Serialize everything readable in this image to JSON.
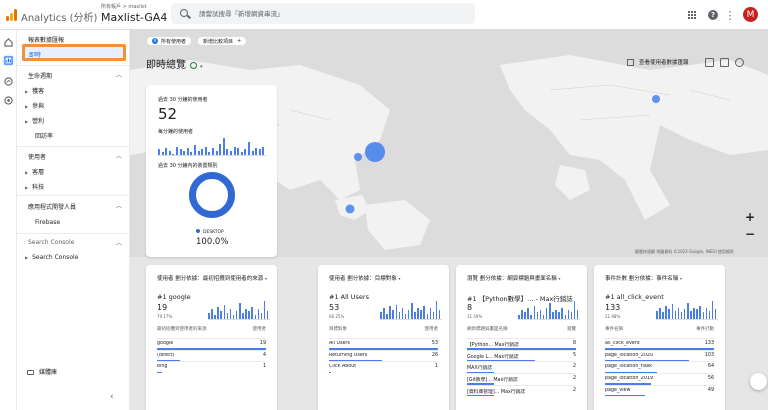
{
  "header": {
    "app_name": "Analytics (分析)",
    "breadcrumb": "所有帳戶 > maxlist",
    "property": "Maxlist-GA4",
    "search_placeholder": "請嘗試搜尋「新增網資串流」",
    "avatar_letter": "M"
  },
  "icons": {
    "logo": "analytics-logo-icon",
    "search": "search-icon",
    "apps": "apps-grid-icon",
    "help": "help-icon",
    "more": "more-vert-icon",
    "settings": "gear-icon"
  },
  "sidebar": {
    "title": "報表數據匯報",
    "active": "即時",
    "sections": [
      {
        "label": "生命週期",
        "items": [
          "獲客",
          "參與",
          "營利"
        ],
        "sub": [
          "回訪率"
        ]
      },
      {
        "label": "使用者",
        "items": [
          "客層",
          "科技"
        ]
      },
      {
        "label": "應用程式開發人員",
        "sub": [
          "Firebase"
        ]
      },
      {
        "label": "Search Console",
        "items": [
          "Search Console"
        ]
      }
    ],
    "library": "媒體庫"
  },
  "main": {
    "chips": [
      "所有使用者",
      "新增比較項目"
    ],
    "page_title": "即時總覽",
    "compare_button": "查看使用者數據匯報",
    "map_credit": "鍵盤快速鍵  地圖資料 ©2023 Google, INEGI  使用條款",
    "zoom_in": "+",
    "zoom_out": "−"
  },
  "realtime_card": {
    "users_label": "過去 30 分鐘的使用者",
    "users_value": "52",
    "per_minute_label": "每分鐘的使用者",
    "device_label": "過去 30 分鐘內的裝置類別",
    "device_name": "DESKTOP",
    "device_pct": "100.0%",
    "per_minute_values": [
      4,
      2,
      5,
      3,
      1,
      6,
      4,
      3,
      5,
      2,
      7,
      3,
      4,
      6,
      2,
      5,
      3,
      8,
      12,
      4,
      3,
      6,
      5,
      2,
      4,
      9,
      3,
      5,
      4,
      6
    ]
  },
  "cards": [
    {
      "title": "使用者 劃分依據：最初招攬到使用者的來源",
      "top_label": "#1  google",
      "top_value": "19",
      "top_pct": "79.17%",
      "col_left": "最初招攬到使用者的來源",
      "col_right": "使用者",
      "rows": [
        {
          "label": "google",
          "value": "19",
          "fill": 1.0
        },
        {
          "label": "(direct)",
          "value": "4",
          "fill": 0.21
        },
        {
          "label": "bing",
          "value": "1",
          "fill": 0.05
        }
      ],
      "bars": [
        3,
        5,
        2,
        6,
        4,
        7,
        3,
        5,
        2,
        4,
        8,
        3,
        5,
        4,
        6,
        2,
        5,
        3,
        9,
        4
      ]
    },
    {
      "title": "使用者 劃分依據：目標對象",
      "top_label": "#1  All Users",
      "top_value": "53",
      "top_pct": "66.25%",
      "col_left": "目標對象",
      "col_right": "使用者",
      "rows": [
        {
          "label": "All Users",
          "value": "53",
          "fill": 1.0
        },
        {
          "label": "Returning Users",
          "value": "26",
          "fill": 0.49
        },
        {
          "label": "Click About",
          "value": "1",
          "fill": 0.02
        }
      ],
      "bars": [
        4,
        6,
        3,
        7,
        5,
        8,
        4,
        6,
        3,
        5,
        9,
        4,
        6,
        5,
        7,
        3,
        6,
        4,
        10,
        5
      ]
    },
    {
      "title": "瀏覽 劃分依據：網頁標題與畫面名稱",
      "top_label": "#1  【Python數學】... - Max行銷誌",
      "top_value": "8",
      "top_pct": "11.59%",
      "col_left": "網頁標題與畫面名稱",
      "col_right": "瀏覽",
      "rows": [
        {
          "label": "【Python... Max行銷誌",
          "value": "8",
          "fill": 1.0
        },
        {
          "label": "Google L... Max行銷誌",
          "value": "5",
          "fill": 0.62
        },
        {
          "label": "MAX行銷誌",
          "value": "2",
          "fill": 0.25
        },
        {
          "label": "[Git教學]... Max行銷誌",
          "value": "2",
          "fill": 0.25
        },
        {
          "label": "[資料庫管理]... Max行銷誌",
          "value": "2",
          "fill": 0.25
        }
      ],
      "bars": [
        2,
        4,
        3,
        5,
        2,
        6,
        3,
        4,
        2,
        5,
        7,
        3,
        4,
        3,
        5,
        2,
        4,
        3,
        8,
        4
      ]
    },
    {
      "title": "事件計數 劃分依據：事件名稱",
      "top_label": "#1  all_click_event",
      "top_value": "133",
      "top_pct": "21.98%",
      "col_left": "事件名稱",
      "col_right": "事件計數",
      "rows": [
        {
          "label": "all_click_event",
          "value": "133",
          "fill": 1.0
        },
        {
          "label": "page_location_2020",
          "value": "103",
          "fill": 0.77
        },
        {
          "label": "page_location_flask",
          "value": "64",
          "fill": 0.48
        },
        {
          "label": "page_location_2019",
          "value": "56",
          "fill": 0.42
        },
        {
          "label": "page_view",
          "value": "49",
          "fill": 0.37
        }
      ],
      "bars": [
        5,
        7,
        4,
        8,
        6,
        9,
        5,
        7,
        4,
        6,
        10,
        5,
        7,
        6,
        8,
        4,
        7,
        5,
        11,
        6
      ]
    }
  ]
}
